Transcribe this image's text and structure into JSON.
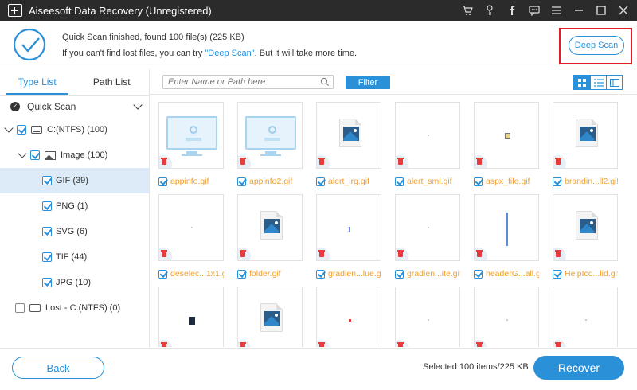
{
  "window": {
    "title": "Aiseesoft Data Recovery (Unregistered)",
    "icons": [
      "cart-icon",
      "key-icon",
      "facebook-icon",
      "feedback-icon",
      "menu-icon",
      "minimize-icon",
      "maximize-icon",
      "close-icon"
    ]
  },
  "status": {
    "line1": "Quick Scan finished, found 100 file(s) (225 KB)",
    "line2_prefix": "If you can't find lost files, you can try ",
    "line2_link": "\"Deep Scan\"",
    "line2_suffix": ". But it will take more time.",
    "deep_scan_label": "Deep Scan"
  },
  "sidebar": {
    "tabs": [
      "Type List",
      "Path List"
    ],
    "quick_scan_label": "Quick Scan",
    "tree": [
      {
        "label": "C:(NTFS) (100)",
        "checked": true
      },
      {
        "label": "Image (100)",
        "checked": true
      },
      {
        "label": "GIF (39)",
        "checked": true,
        "selected": true
      },
      {
        "label": "PNG (1)",
        "checked": true
      },
      {
        "label": "SVG (6)",
        "checked": true
      },
      {
        "label": "TIF (44)",
        "checked": true
      },
      {
        "label": "JPG (10)",
        "checked": true
      },
      {
        "label": "Lost - C:(NTFS) (0)",
        "checked": false
      }
    ]
  },
  "toolbar": {
    "search_placeholder": "Enter Name or Path here",
    "filter_label": "Filter"
  },
  "files": [
    {
      "name": "appinfo.gif",
      "thumb": "monitor"
    },
    {
      "name": "appinfo2.gif",
      "thumb": "monitor"
    },
    {
      "name": "alert_lrg.gif",
      "thumb": "file"
    },
    {
      "name": "alert_sml.gif",
      "thumb": "blank"
    },
    {
      "name": "aspx_file.gif",
      "thumb": "small"
    },
    {
      "name": "brandin...ll2.gif",
      "thumb": "file"
    },
    {
      "name": "deselec...1x1.gif",
      "thumb": "blank"
    },
    {
      "name": "folder.gif",
      "thumb": "file"
    },
    {
      "name": "gradien...lue.gif",
      "thumb": "blueline"
    },
    {
      "name": "gradien...ite.gif",
      "thumb": "blank"
    },
    {
      "name": "headerG...all.gif",
      "thumb": "vline"
    },
    {
      "name": "HelpIco...lid.gif",
      "thumb": "file"
    },
    {
      "name": "",
      "thumb": "darkicon"
    },
    {
      "name": "",
      "thumb": "file"
    },
    {
      "name": "",
      "thumb": "reddot"
    },
    {
      "name": "",
      "thumb": "blank"
    },
    {
      "name": "",
      "thumb": "blank"
    },
    {
      "name": "",
      "thumb": "blank"
    }
  ],
  "footer": {
    "back_label": "Back",
    "selected_text": "Selected 100 items/225 KB",
    "recover_label": "Recover"
  },
  "colors": {
    "accent": "#2a90d8",
    "titlebar": "#2b2b2b",
    "file_label": "#f0a030",
    "highlight_frame": "#e21f26",
    "selected_row": "#dcebf7"
  }
}
